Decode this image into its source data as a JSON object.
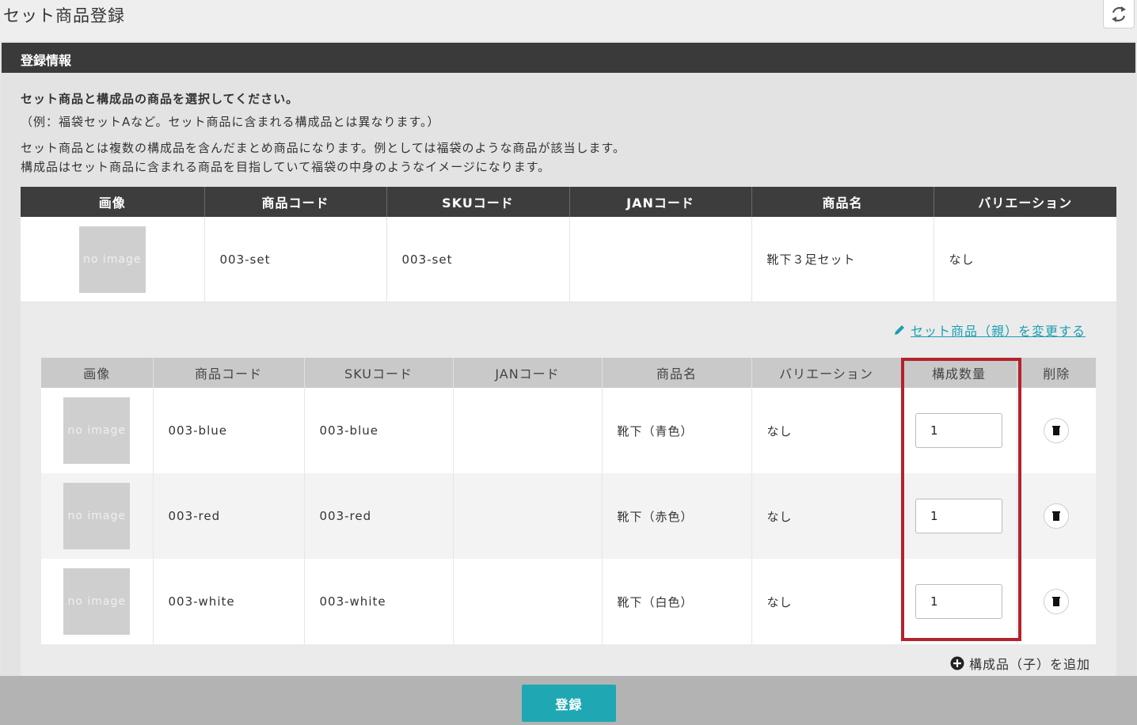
{
  "page": {
    "title": "セット商品登録"
  },
  "toolbar": {
    "refresh_icon": "refresh-icon"
  },
  "section": {
    "header": "登録情報"
  },
  "intro": {
    "line1": "セット商品と構成品の商品を選択してください。",
    "line2": "（例：福袋セットAなど。セット商品に含まれる構成品とは異なります。）",
    "line3": "セット商品とは複数の構成品を含んだまとめ商品になります。例としては福袋のような商品が該当します。",
    "line4": "構成品はセット商品に含まれる商品を目指していて福袋の中身のようなイメージになります。"
  },
  "parent_table": {
    "headers": [
      "画像",
      "商品コード",
      "SKUコード",
      "JANコード",
      "商品名",
      "バリエーション"
    ],
    "row": {
      "image": "no image",
      "product_code": "003-set",
      "sku_code": "003-set",
      "jan_code": "",
      "name": "靴下３足セット",
      "variation": "なし"
    }
  },
  "change_parent_link": "セット商品（親）を変更する",
  "child_table": {
    "headers": [
      "画像",
      "商品コード",
      "SKUコード",
      "JANコード",
      "商品名",
      "バリエーション",
      "構成数量",
      "削除"
    ],
    "rows": [
      {
        "image": "no image",
        "product_code": "003-blue",
        "sku_code": "003-blue",
        "jan_code": "",
        "name": "靴下（青色）",
        "variation": "なし",
        "quantity": "1"
      },
      {
        "image": "no image",
        "product_code": "003-red",
        "sku_code": "003-red",
        "jan_code": "",
        "name": "靴下（赤色）",
        "variation": "なし",
        "quantity": "1"
      },
      {
        "image": "no image",
        "product_code": "003-white",
        "sku_code": "003-white",
        "jan_code": "",
        "name": "靴下（白色）",
        "variation": "なし",
        "quantity": "1"
      }
    ]
  },
  "add_child_link": "構成品（子）を追加",
  "footer": {
    "register_label": "登録"
  },
  "colors": {
    "accent": "#1fa8b3",
    "highlight": "#b3232b",
    "header_dark": "#3a3a3a"
  }
}
